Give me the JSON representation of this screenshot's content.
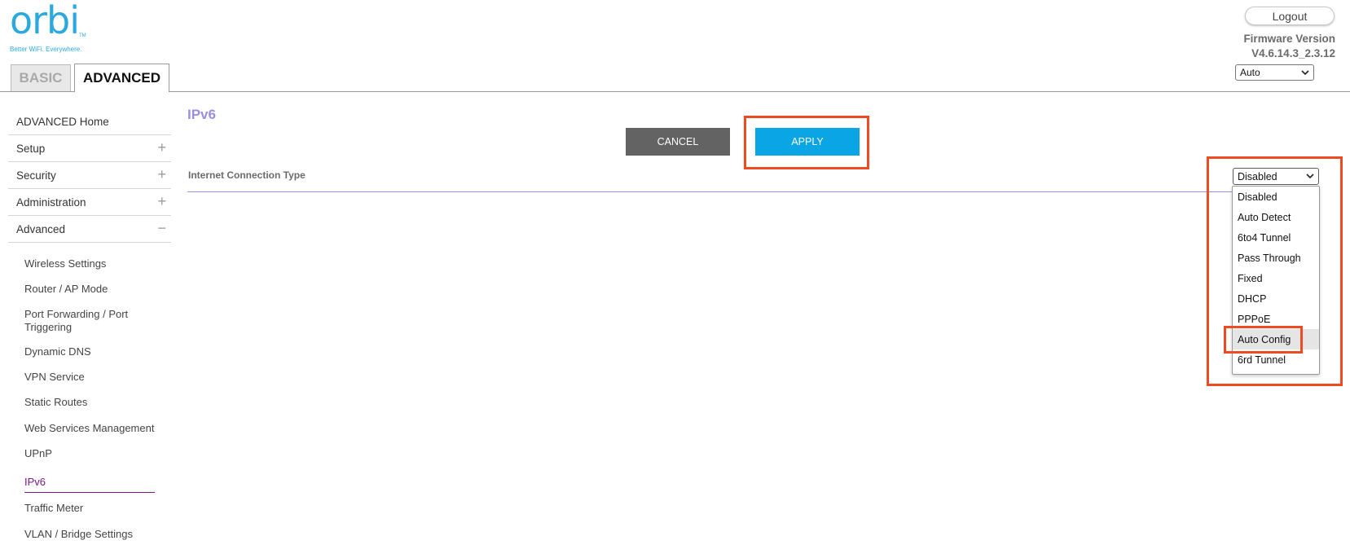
{
  "header": {
    "logo_text": "orbi",
    "logo_tm": "TM",
    "tagline": "Better WiFi. Everywhere.",
    "tabs": [
      {
        "label": "BASIC",
        "active": false
      },
      {
        "label": "ADVANCED",
        "active": true
      }
    ],
    "logout_label": "Logout",
    "firmware_label": "Firmware Version",
    "firmware_value": "V4.6.14.3_2.3.12",
    "language_selected": "Auto"
  },
  "sidebar": {
    "items": [
      {
        "label": "ADVANCED Home",
        "expander": ""
      },
      {
        "label": "Setup",
        "expander": "+"
      },
      {
        "label": "Security",
        "expander": "+"
      },
      {
        "label": "Administration",
        "expander": "+"
      },
      {
        "label": "Advanced",
        "expander": "−"
      }
    ],
    "subitems": [
      {
        "label": "Wireless Settings"
      },
      {
        "label": "Router / AP Mode"
      },
      {
        "label": "Port Forwarding / Port Triggering"
      },
      {
        "label": "Dynamic DNS"
      },
      {
        "label": "VPN Service"
      },
      {
        "label": "Static Routes"
      },
      {
        "label": "Web Services Management"
      },
      {
        "label": "UPnP"
      },
      {
        "label": "IPv6",
        "active": true
      },
      {
        "label": "Traffic Meter"
      },
      {
        "label": "VLAN / Bridge Settings"
      }
    ]
  },
  "main": {
    "title": "IPv6",
    "cancel_label": "CANCEL",
    "apply_label": "APPLY",
    "field_label": "Internet Connection Type",
    "connection_selected": "Disabled",
    "connection_options": [
      "Disabled",
      "Auto Detect",
      "6to4 Tunnel",
      "Pass Through",
      "Fixed",
      "DHCP",
      "PPPoE",
      "Auto Config",
      "6rd Tunnel"
    ],
    "hovered_option": "Auto Config"
  },
  "colors": {
    "brand_blue": "#2aa9e0",
    "apply_blue": "#0aa5e5",
    "cancel_gray": "#636363",
    "highlight_red": "#ef4b23",
    "title_purple": "#9a8fe0",
    "active_nav": "#7a1a86"
  },
  "icons": {
    "expand": "plus-icon",
    "collapse": "minus-icon",
    "select_arrow": "chevron-down-icon"
  }
}
